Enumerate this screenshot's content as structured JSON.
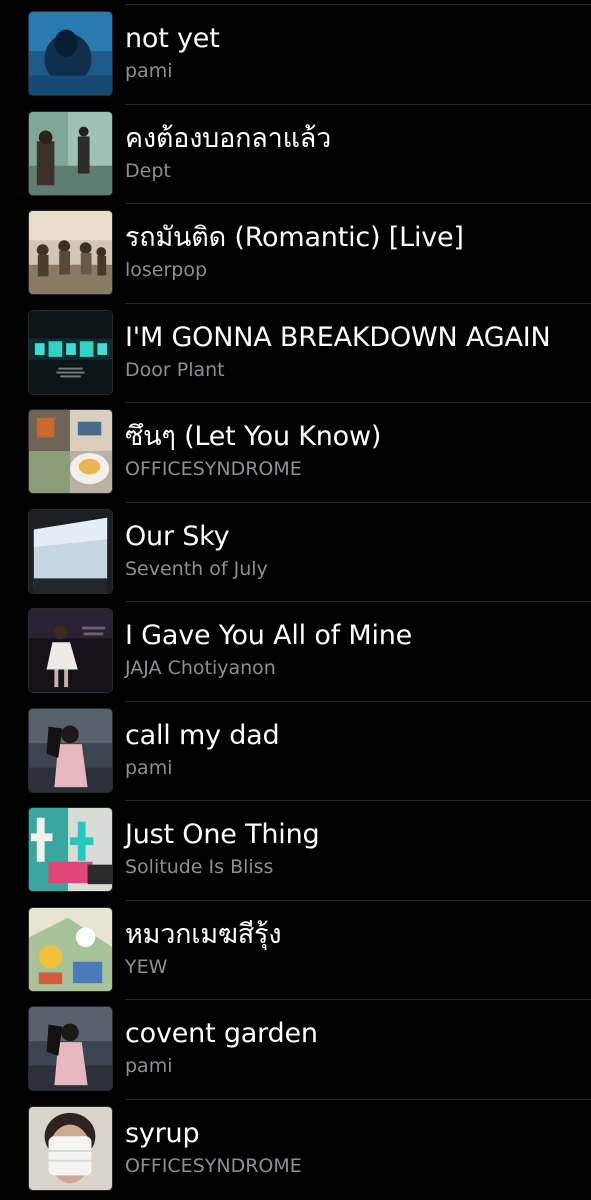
{
  "songs": [
    {
      "title": "not yet",
      "artist": "pami",
      "artwork": "album-art-blue-portrait"
    },
    {
      "title": "คงต้องบอกลาแล้ว",
      "artist": "Dept",
      "artwork": "album-art-green-room"
    },
    {
      "title": "รถมันติด (Romantic) [Live]",
      "artist": "loserpop",
      "artwork": "album-art-band-live"
    },
    {
      "title": "I'M GONNA BREAKDOWN AGAIN",
      "artist": "Door Plant",
      "artwork": "album-art-dark-teal-text"
    },
    {
      "title": "ซึนๆ (Let You Know)",
      "artist": "OFFICESYNDROME",
      "artwork": "album-art-collage-food"
    },
    {
      "title": "Our Sky",
      "artist": "Seventh of July",
      "artwork": "album-art-sky-building"
    },
    {
      "title": "I Gave You All of Mine",
      "artist": "JAJA Chotiyanon",
      "artwork": "album-art-dancer-dark"
    },
    {
      "title": "call my dad",
      "artist": "pami",
      "artwork": "album-art-girl-pink"
    },
    {
      "title": "Just One Thing",
      "artist": "Solitude Is Bliss",
      "artwork": "album-art-teal-graffiti"
    },
    {
      "title": "หมวกเมฆสีรุ้ง",
      "artist": "YEW",
      "artwork": "album-art-illustrated-collage"
    },
    {
      "title": "covent garden",
      "artist": "pami",
      "artwork": "album-art-girl-pink"
    },
    {
      "title": "syrup",
      "artist": "OFFICESYNDROME",
      "artwork": "album-art-masked-face"
    }
  ]
}
